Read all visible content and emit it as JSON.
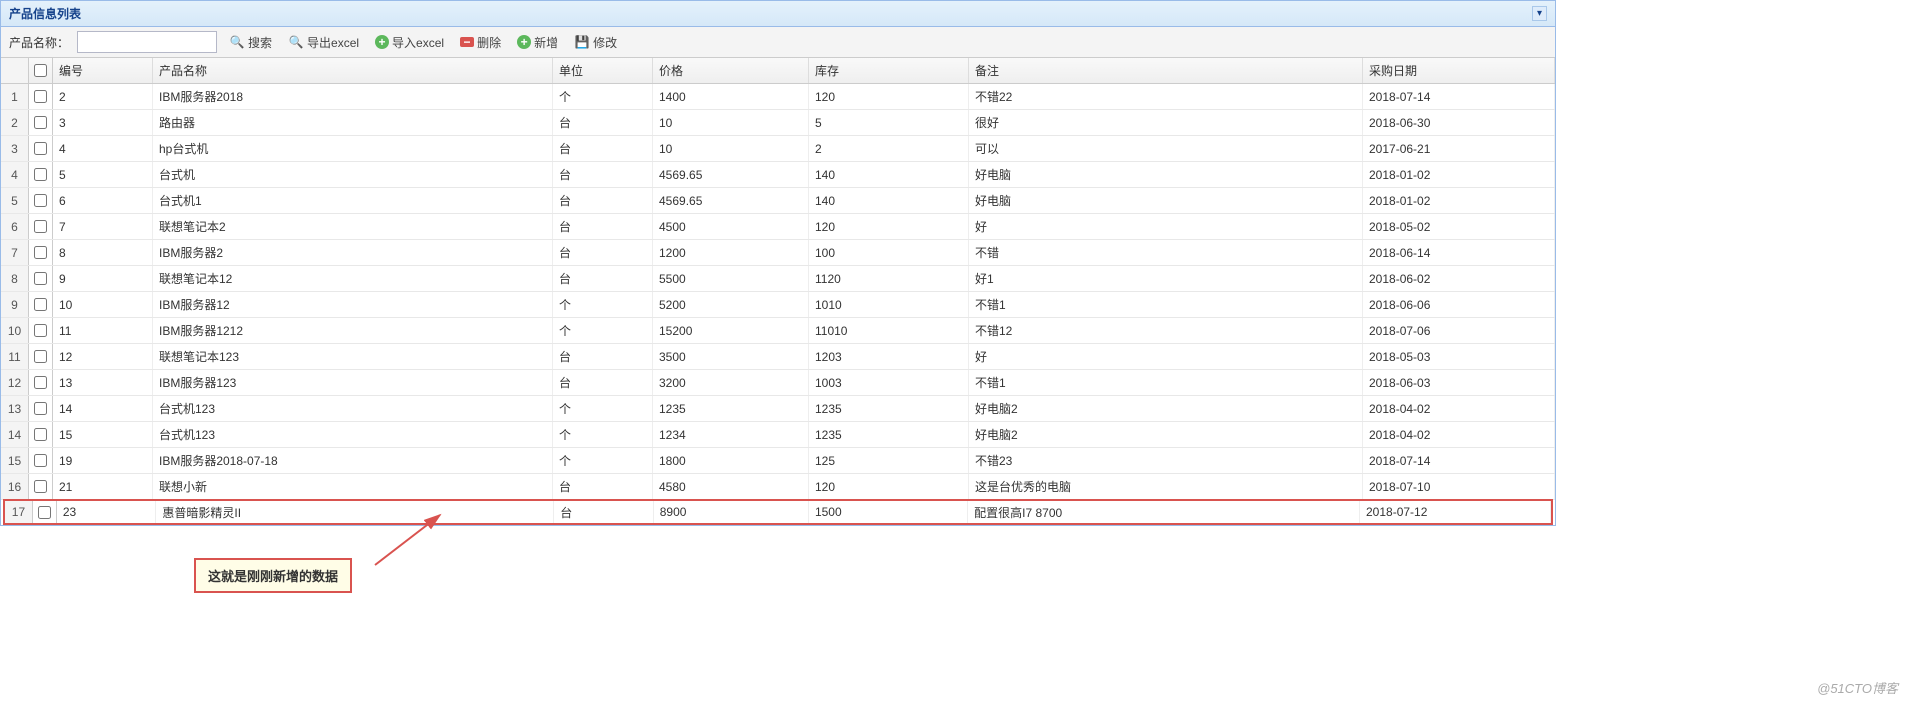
{
  "panel": {
    "title": "产品信息列表"
  },
  "toolbar": {
    "name_label": "产品名称：",
    "search_placeholder": "",
    "btn_search": "搜索",
    "btn_export": "导出excel",
    "btn_import": "导入excel",
    "btn_delete": "删除",
    "btn_add": "新增",
    "btn_edit": "修改"
  },
  "columns": {
    "id": "编号",
    "name": "产品名称",
    "unit": "单位",
    "price": "价格",
    "stock": "库存",
    "remark": "备注",
    "date": "采购日期"
  },
  "rows": [
    {
      "num": "1",
      "id": "2",
      "name": "IBM服务器2018",
      "unit": "个",
      "price": "1400",
      "stock": "120",
      "remark": "不错22",
      "date": "2018-07-14",
      "hl": false
    },
    {
      "num": "2",
      "id": "3",
      "name": "路由器",
      "unit": "台",
      "price": "10",
      "stock": "5",
      "remark": "很好",
      "date": "2018-06-30",
      "hl": false
    },
    {
      "num": "3",
      "id": "4",
      "name": "hp台式机",
      "unit": "台",
      "price": "10",
      "stock": "2",
      "remark": "可以",
      "date": "2017-06-21",
      "hl": false
    },
    {
      "num": "4",
      "id": "5",
      "name": "台式机",
      "unit": "台",
      "price": "4569.65",
      "stock": "140",
      "remark": "好电脑",
      "date": "2018-01-02",
      "hl": false
    },
    {
      "num": "5",
      "id": "6",
      "name": "台式机1",
      "unit": "台",
      "price": "4569.65",
      "stock": "140",
      "remark": "好电脑",
      "date": "2018-01-02",
      "hl": false
    },
    {
      "num": "6",
      "id": "7",
      "name": "联想笔记本2",
      "unit": "台",
      "price": "4500",
      "stock": "120",
      "remark": "好",
      "date": "2018-05-02",
      "hl": false
    },
    {
      "num": "7",
      "id": "8",
      "name": "IBM服务器2",
      "unit": "台",
      "price": "1200",
      "stock": "100",
      "remark": "不错",
      "date": "2018-06-14",
      "hl": false
    },
    {
      "num": "8",
      "id": "9",
      "name": "联想笔记本12",
      "unit": "台",
      "price": "5500",
      "stock": "1120",
      "remark": "好1",
      "date": "2018-06-02",
      "hl": false
    },
    {
      "num": "9",
      "id": "10",
      "name": "IBM服务器12",
      "unit": "个",
      "price": "5200",
      "stock": "1010",
      "remark": "不错1",
      "date": "2018-06-06",
      "hl": false
    },
    {
      "num": "10",
      "id": "11",
      "name": "IBM服务器1212",
      "unit": "个",
      "price": "15200",
      "stock": "11010",
      "remark": "不错12",
      "date": "2018-07-06",
      "hl": false
    },
    {
      "num": "11",
      "id": "12",
      "name": "联想笔记本123",
      "unit": "台",
      "price": "3500",
      "stock": "1203",
      "remark": "好",
      "date": "2018-05-03",
      "hl": false
    },
    {
      "num": "12",
      "id": "13",
      "name": "IBM服务器123",
      "unit": "台",
      "price": "3200",
      "stock": "1003",
      "remark": "不错1",
      "date": "2018-06-03",
      "hl": false
    },
    {
      "num": "13",
      "id": "14",
      "name": "台式机123",
      "unit": "个",
      "price": "1235",
      "stock": "1235",
      "remark": "好电脑2",
      "date": "2018-04-02",
      "hl": false
    },
    {
      "num": "14",
      "id": "15",
      "name": "台式机123",
      "unit": "个",
      "price": "1234",
      "stock": "1235",
      "remark": "好电脑2",
      "date": "2018-04-02",
      "hl": false
    },
    {
      "num": "15",
      "id": "19",
      "name": "IBM服务器2018-07-18",
      "unit": "个",
      "price": "1800",
      "stock": "125",
      "remark": "不错23",
      "date": "2018-07-14",
      "hl": false
    },
    {
      "num": "16",
      "id": "21",
      "name": "联想小新",
      "unit": "台",
      "price": "4580",
      "stock": "120",
      "remark": "这是台优秀的电脑",
      "date": "2018-07-10",
      "hl": false
    },
    {
      "num": "17",
      "id": "23",
      "name": "惠普暗影精灵II",
      "unit": "台",
      "price": "8900",
      "stock": "1500",
      "remark": "配置很高I7 8700",
      "date": "2018-07-12",
      "hl": true
    }
  ],
  "annotation": {
    "text": "这就是刚刚新增的数据"
  },
  "watermark": "@51CTO博客"
}
